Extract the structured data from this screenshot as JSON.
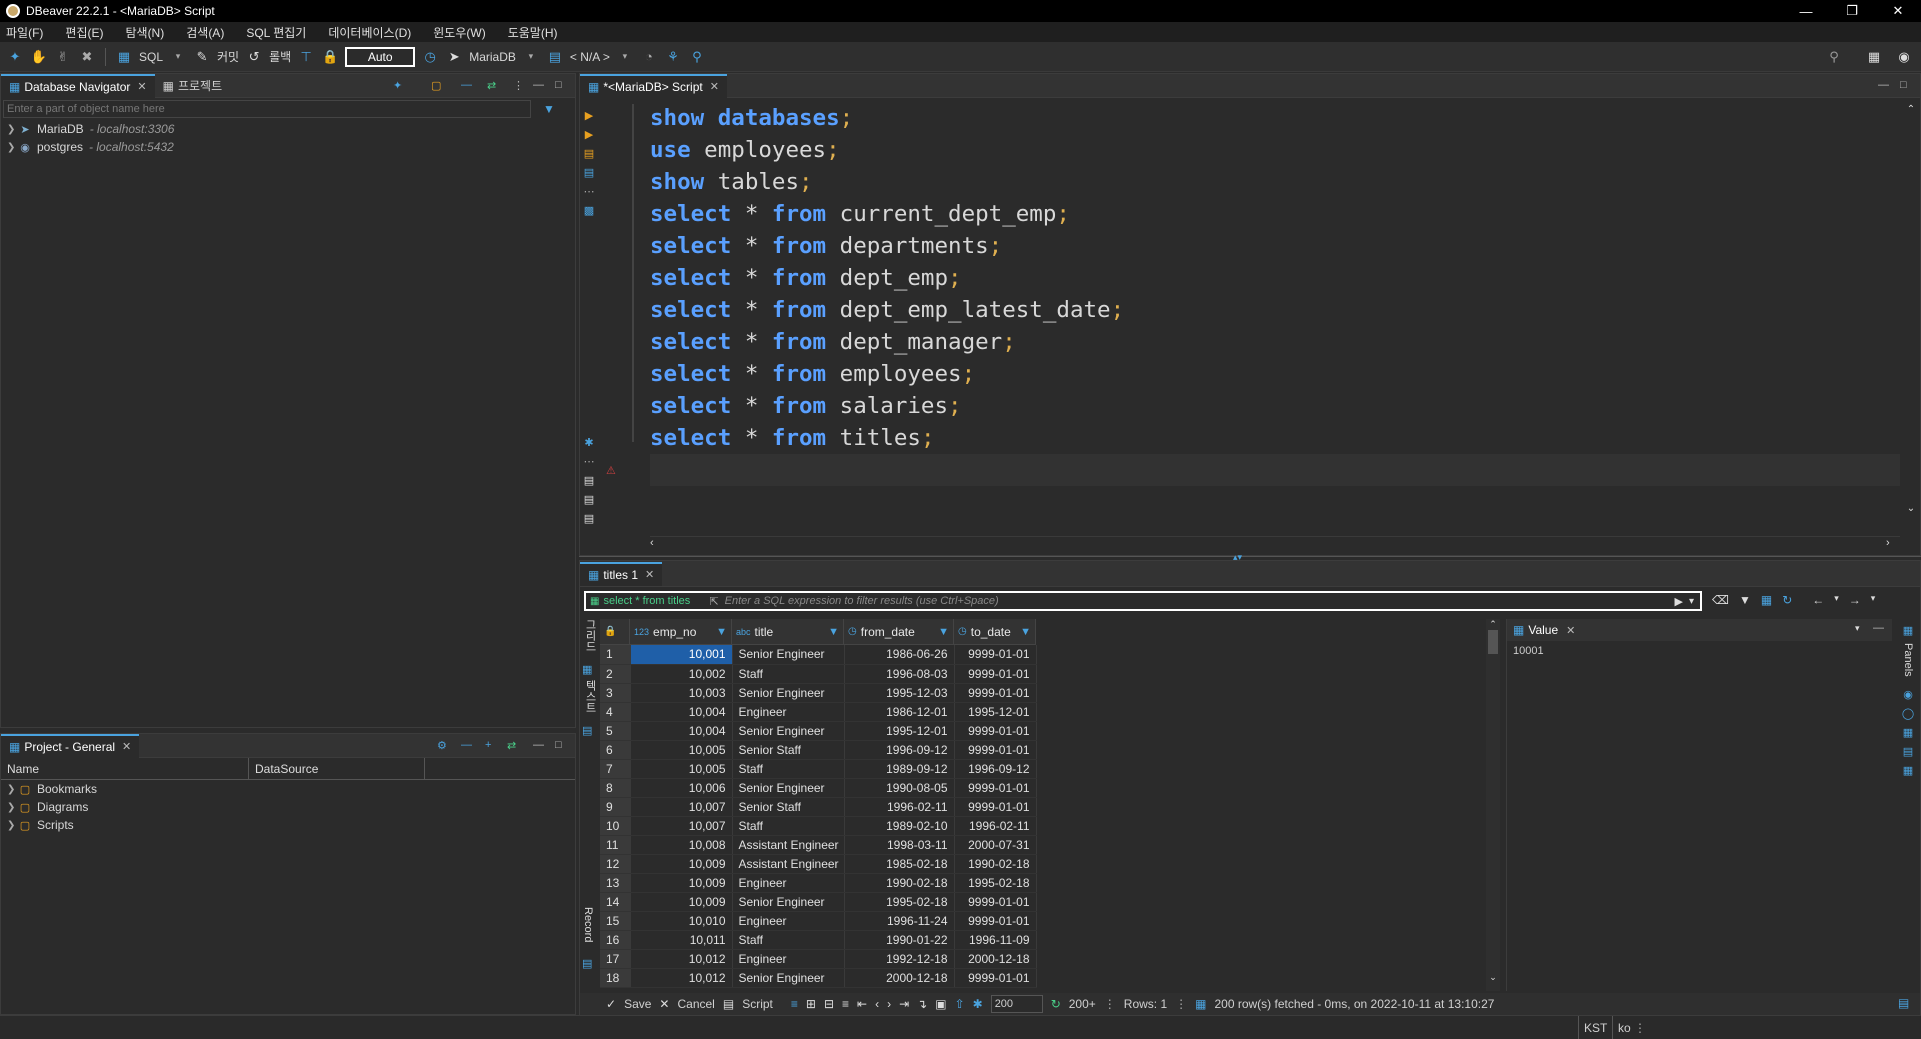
{
  "window": {
    "title": "DBeaver 22.2.1 - <MariaDB> Script"
  },
  "menu": [
    "파일(F)",
    "편집(E)",
    "탐색(N)",
    "검색(A)",
    "SQL 편집기",
    "데이터베이스(D)",
    "윈도우(W)",
    "도움말(H)"
  ],
  "toolbar": {
    "sql_label": "SQL",
    "commit_label": "커밋",
    "rollback_label": "롤백",
    "auto_label": "Auto",
    "datasource_label": "MariaDB",
    "schema_label": "< N/A >"
  },
  "navigator": {
    "tab_label": "Database Navigator",
    "project_tab_label": "프로젝트",
    "filter_placeholder": "Enter a part of object name here",
    "connections": [
      {
        "name": "MariaDB",
        "host": "- localhost:3306",
        "icon": "mariadb-icon"
      },
      {
        "name": "postgres",
        "host": "- localhost:5432",
        "icon": "postgres-icon"
      }
    ]
  },
  "project": {
    "tab_label": "Project - General",
    "col_name": "Name",
    "col_datasource": "DataSource",
    "items": [
      "Bookmarks",
      "Diagrams",
      "Scripts"
    ]
  },
  "editor": {
    "tab_label": "*<MariaDB> Script",
    "lines": [
      [
        [
          "kw",
          "show"
        ],
        [
          "t",
          " "
        ],
        [
          "kw",
          "databases"
        ],
        [
          "s",
          ";"
        ]
      ],
      [
        [
          "kw",
          "use"
        ],
        [
          "t",
          " employees"
        ],
        [
          "s",
          ";"
        ]
      ],
      [
        [
          "kw",
          "show"
        ],
        [
          "t",
          " tables"
        ],
        [
          "s",
          ";"
        ]
      ],
      [
        [
          "kw",
          "select"
        ],
        [
          "t",
          " * "
        ],
        [
          "kw",
          "from"
        ],
        [
          "t",
          " current_dept_emp"
        ],
        [
          "s",
          ";"
        ]
      ],
      [
        [
          "kw",
          "select"
        ],
        [
          "t",
          " * "
        ],
        [
          "kw",
          "from"
        ],
        [
          "t",
          " departments"
        ],
        [
          "s",
          ";"
        ]
      ],
      [
        [
          "kw",
          "select"
        ],
        [
          "t",
          " * "
        ],
        [
          "kw",
          "from"
        ],
        [
          "t",
          " dept_emp"
        ],
        [
          "s",
          ";"
        ]
      ],
      [
        [
          "kw",
          "select"
        ],
        [
          "t",
          " * "
        ],
        [
          "kw",
          "from"
        ],
        [
          "t",
          " dept_emp_latest_date"
        ],
        [
          "s",
          ";"
        ]
      ],
      [
        [
          "kw",
          "select"
        ],
        [
          "t",
          " * "
        ],
        [
          "kw",
          "from"
        ],
        [
          "t",
          " dept_manager"
        ],
        [
          "s",
          ";"
        ]
      ],
      [
        [
          "kw",
          "select"
        ],
        [
          "t",
          " * "
        ],
        [
          "kw",
          "from"
        ],
        [
          "t",
          " employees"
        ],
        [
          "s",
          ";"
        ]
      ],
      [
        [
          "kw",
          "select"
        ],
        [
          "t",
          " * "
        ],
        [
          "kw",
          "from"
        ],
        [
          "t",
          " salaries"
        ],
        [
          "s",
          ";"
        ]
      ],
      [
        [
          "kw",
          "select"
        ],
        [
          "t",
          " * "
        ],
        [
          "kw",
          "from"
        ],
        [
          "t",
          " titles"
        ],
        [
          "s",
          ";"
        ]
      ]
    ]
  },
  "results": {
    "tab_label": "titles 1",
    "filter_query": "select * from titles",
    "filter_placeholder": "Enter a SQL expression to filter results (use Ctrl+Space)",
    "columns": [
      {
        "name": "emp_no",
        "type_icon": "123"
      },
      {
        "name": "title",
        "type_icon": "abc"
      },
      {
        "name": "from_date",
        "type_icon": "clock"
      },
      {
        "name": "to_date",
        "type_icon": "clock"
      }
    ],
    "rows": [
      [
        "1",
        "10,001",
        "Senior Engineer",
        "1986-06-26",
        "9999-01-01"
      ],
      [
        "2",
        "10,002",
        "Staff",
        "1996-08-03",
        "9999-01-01"
      ],
      [
        "3",
        "10,003",
        "Senior Engineer",
        "1995-12-03",
        "9999-01-01"
      ],
      [
        "4",
        "10,004",
        "Engineer",
        "1986-12-01",
        "1995-12-01"
      ],
      [
        "5",
        "10,004",
        "Senior Engineer",
        "1995-12-01",
        "9999-01-01"
      ],
      [
        "6",
        "10,005",
        "Senior Staff",
        "1996-09-12",
        "9999-01-01"
      ],
      [
        "7",
        "10,005",
        "Staff",
        "1989-09-12",
        "1996-09-12"
      ],
      [
        "8",
        "10,006",
        "Senior Engineer",
        "1990-08-05",
        "9999-01-01"
      ],
      [
        "9",
        "10,007",
        "Senior Staff",
        "1996-02-11",
        "9999-01-01"
      ],
      [
        "10",
        "10,007",
        "Staff",
        "1989-02-10",
        "1996-02-11"
      ],
      [
        "11",
        "10,008",
        "Assistant Engineer",
        "1998-03-11",
        "2000-07-31"
      ],
      [
        "12",
        "10,009",
        "Assistant Engineer",
        "1985-02-18",
        "1990-02-18"
      ],
      [
        "13",
        "10,009",
        "Engineer",
        "1990-02-18",
        "1995-02-18"
      ],
      [
        "14",
        "10,009",
        "Senior Engineer",
        "1995-02-18",
        "9999-01-01"
      ],
      [
        "15",
        "10,010",
        "Engineer",
        "1996-11-24",
        "9999-01-01"
      ],
      [
        "16",
        "10,011",
        "Staff",
        "1990-01-22",
        "1996-11-09"
      ],
      [
        "17",
        "10,012",
        "Engineer",
        "1992-12-18",
        "2000-12-18"
      ],
      [
        "18",
        "10,012",
        "Senior Engineer",
        "2000-12-18",
        "9999-01-01"
      ]
    ],
    "value_panel": {
      "tab_label": "Value",
      "value": "10001"
    },
    "side_labels": {
      "grid": "그리드",
      "text": "텍스트",
      "record": "Record",
      "panels": "Panels"
    },
    "bottom": {
      "save": "Save",
      "cancel": "Cancel",
      "script": "Script",
      "fetch_size": "200",
      "fetch_more": "200+",
      "rows_info": "Rows: 1",
      "status": "200 row(s) fetched - 0ms, on 2022-10-11 at 13:10:27"
    }
  },
  "statusbar": {
    "timezone": "KST",
    "locale": "ko"
  },
  "colors": {
    "keyword": "#5aa0ff",
    "semicolon": "#e0b050",
    "accent": "#4aa3df",
    "selected_cell": "#1f5fa8"
  }
}
